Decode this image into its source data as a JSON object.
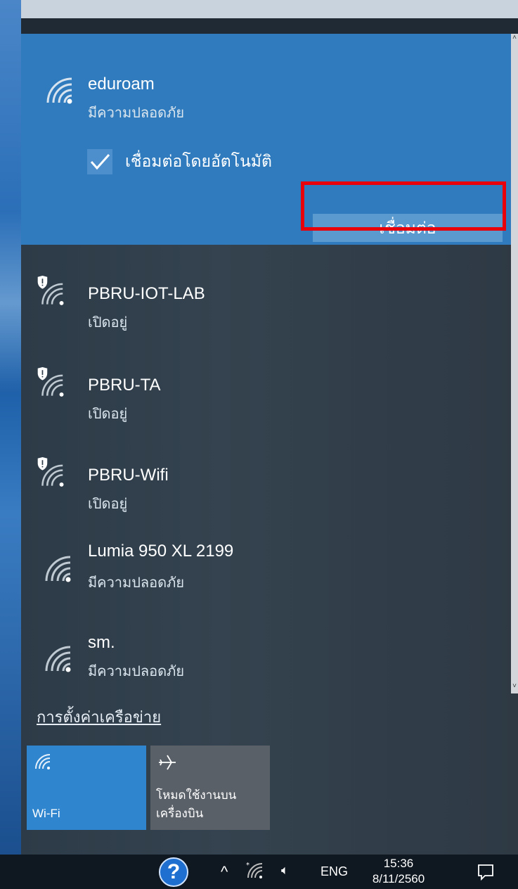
{
  "networks": {
    "selected": {
      "name": "eduroam",
      "status": "มีความปลอดภัย",
      "auto_connect_label": "เชื่อมต่อโดยอัตโนมัติ",
      "auto_connect_checked": true,
      "connect_label": "เชื่อมต่อ"
    },
    "list": [
      {
        "name": "PBRU-IOT-LAB",
        "status": "เปิดอยู่",
        "secured": false,
        "icon": "wifi-shield-icon"
      },
      {
        "name": "PBRU-TA",
        "status": "เปิดอยู่",
        "secured": false,
        "icon": "wifi-shield-icon"
      },
      {
        "name": "PBRU-Wifi",
        "status": "เปิดอยู่",
        "secured": false,
        "icon": "wifi-shield-icon"
      },
      {
        "name": "Lumia 950 XL 2199",
        "status": "มีความปลอดภัย",
        "secured": true,
        "icon": "wifi-icon"
      },
      {
        "name": "sm.",
        "status": "มีความปลอดภัย",
        "secured": true,
        "icon": "wifi-icon"
      }
    ]
  },
  "settings_link": "การตั้งค่าเครือข่าย",
  "quick_actions": {
    "wifi_label": "Wi-Fi",
    "airplane_label_line1": "โหมดใช้งานบน",
    "airplane_label_line2": "เครื่องบิน"
  },
  "taskbar": {
    "help_icon": "help-icon",
    "language": "ENG",
    "time": "15:36",
    "date": "8/11/2560"
  },
  "colors": {
    "selected_bg": "#2f7bbd",
    "highlight": "#e8000b",
    "wifi_tile": "#2f86cf"
  }
}
